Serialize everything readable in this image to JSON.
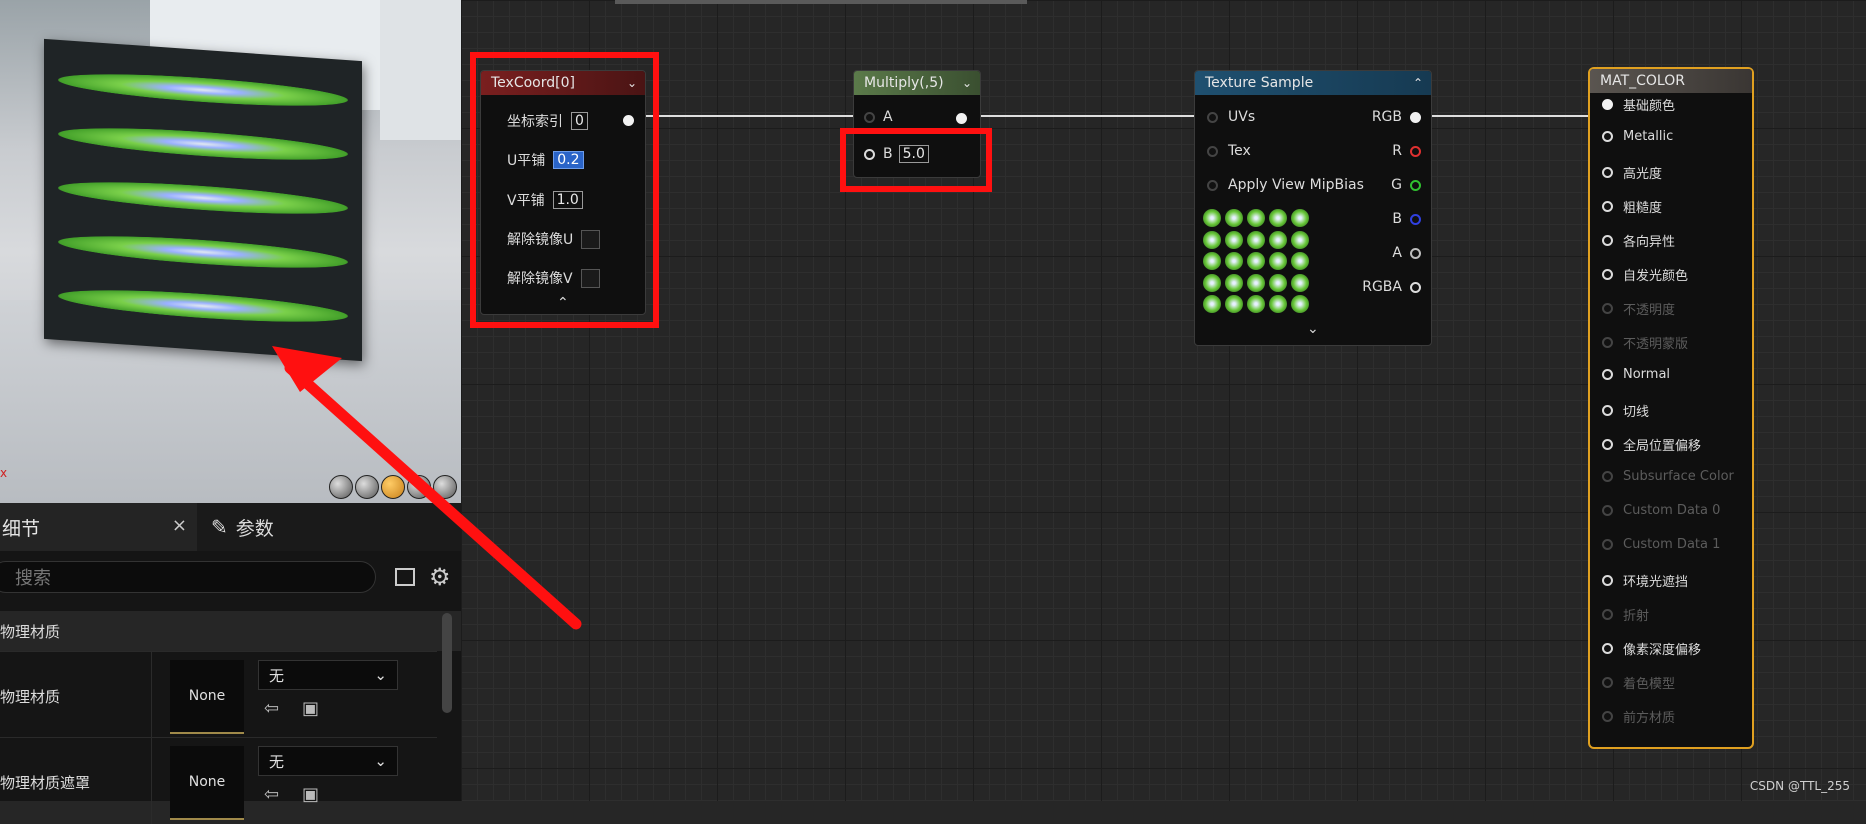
{
  "nodes": {
    "texcoord": {
      "title": "TexCoord[0]",
      "rows": {
        "coord_index_label": "坐标索引",
        "coord_index_value": "0",
        "u_tiling_label": "U平铺",
        "u_tiling_value": "0.2",
        "v_tiling_label": "V平铺",
        "v_tiling_value": "1.0",
        "unmirror_u_label": "解除镜像U",
        "unmirror_v_label": "解除镜像V"
      },
      "collapse_glyph": "⌃"
    },
    "multiply": {
      "title": "Multiply(,5)",
      "pin_a": "A",
      "pin_b": "B",
      "b_value": "5.0"
    },
    "texture_sample": {
      "title": "Texture Sample",
      "inputs": [
        "UVs",
        "Tex",
        "Apply View MipBias"
      ],
      "outputs": [
        "RGB",
        "R",
        "G",
        "B",
        "A",
        "RGBA"
      ],
      "expand_glyph": "⌄"
    },
    "mat_color": {
      "title": "MAT_COLOR",
      "pins": [
        {
          "label": "基础颜色",
          "state": "connected"
        },
        {
          "label": "Metallic",
          "state": "active"
        },
        {
          "label": "高光度",
          "state": "active"
        },
        {
          "label": "粗糙度",
          "state": "active"
        },
        {
          "label": "各向异性",
          "state": "active"
        },
        {
          "label": "自发光颜色",
          "state": "active"
        },
        {
          "label": "不透明度",
          "state": "disabled"
        },
        {
          "label": "不透明蒙版",
          "state": "disabled"
        },
        {
          "label": "Normal",
          "state": "active"
        },
        {
          "label": "切线",
          "state": "active"
        },
        {
          "label": "全局位置偏移",
          "state": "active"
        },
        {
          "label": "Subsurface Color",
          "state": "disabled"
        },
        {
          "label": "Custom Data 0",
          "state": "disabled"
        },
        {
          "label": "Custom Data 1",
          "state": "disabled"
        },
        {
          "label": "环境光遮挡",
          "state": "active"
        },
        {
          "label": "折射",
          "state": "disabled"
        },
        {
          "label": "像素深度偏移",
          "state": "active"
        },
        {
          "label": "着色模型",
          "state": "disabled"
        },
        {
          "label": "前方材质",
          "state": "disabled"
        }
      ]
    }
  },
  "details": {
    "tab_details": "细节",
    "tab_close": "×",
    "tab_params": "参数",
    "search_placeholder": "搜索",
    "section_title": "物理材质",
    "props": [
      {
        "label": "物理材质",
        "thumb": "None",
        "combo": "无"
      },
      {
        "label": "物理材质遮罩",
        "thumb": "None",
        "combo": "无"
      }
    ]
  },
  "colors": {
    "highlight": "#ff1010",
    "texcoord_header": "#7a1f1f",
    "multiply_header": "#4f6a40",
    "texture_header": "#1f5070",
    "mat_border": "#e0a020",
    "pin_r": "#e03030",
    "pin_g": "#30c030",
    "pin_b": "#3040e0"
  },
  "watermark": "CSDN @TTL_255"
}
